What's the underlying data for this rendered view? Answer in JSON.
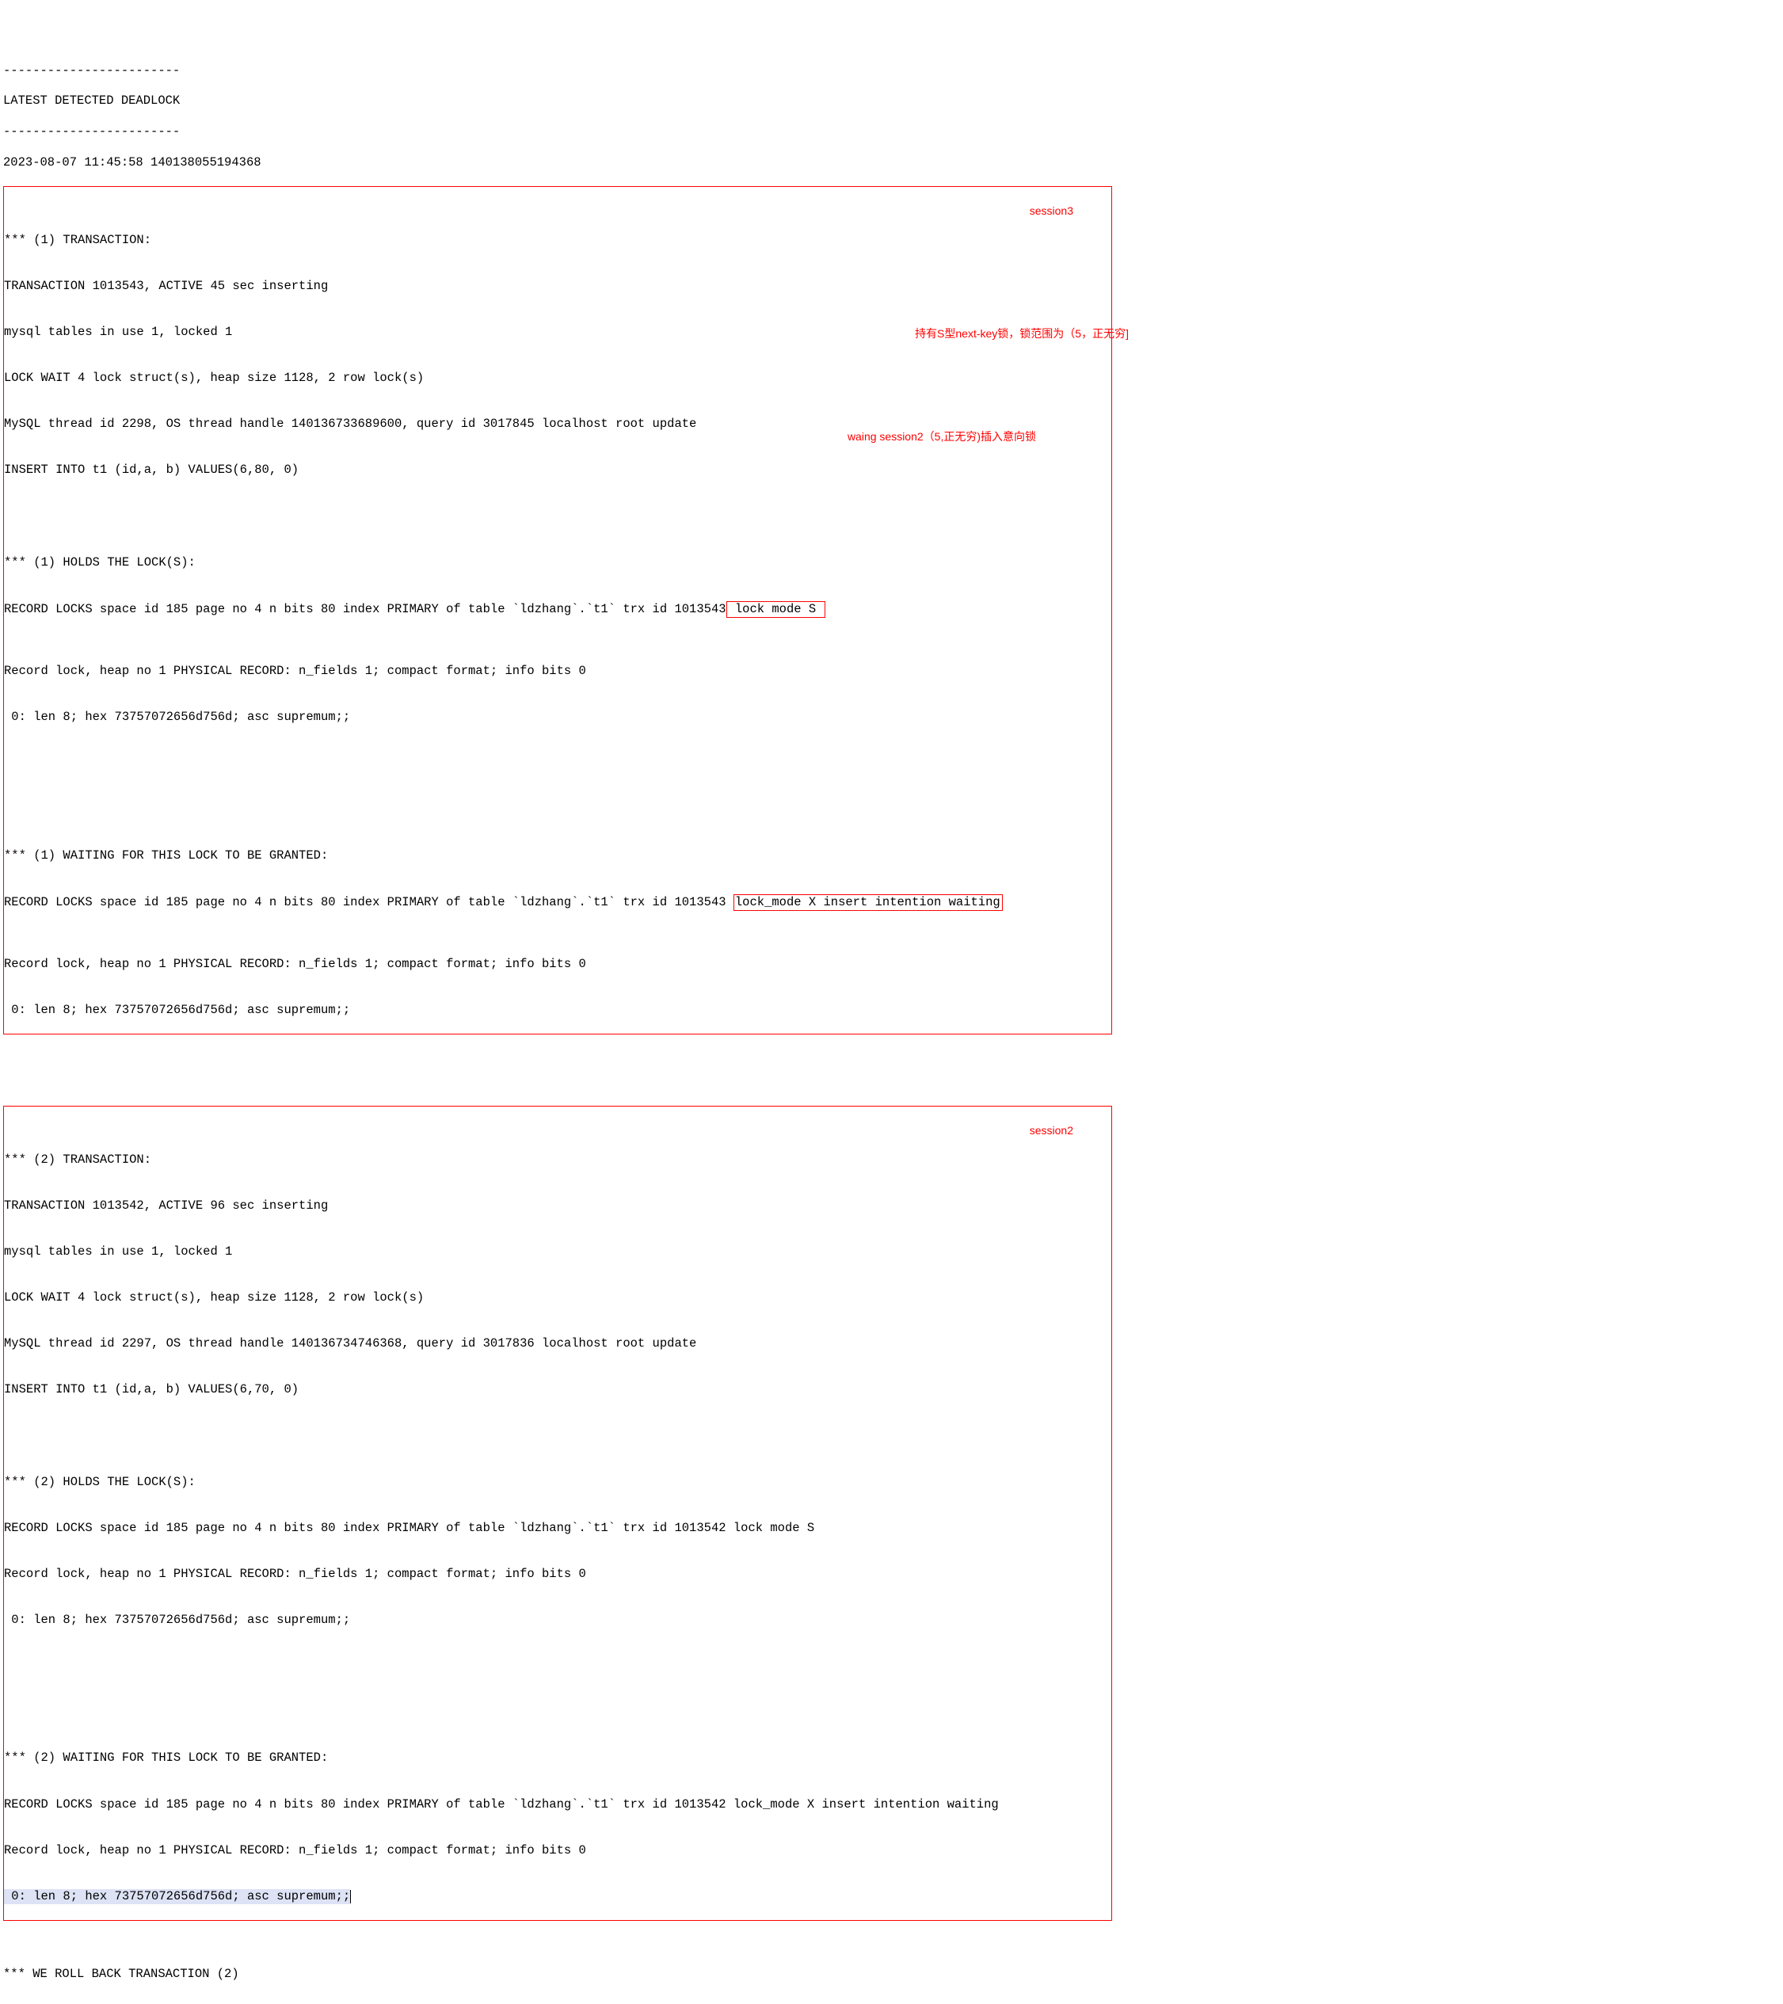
{
  "header": {
    "dashes_top": "------------------------",
    "title": "LATEST DETECTED DEADLOCK",
    "dashes_bottom": "------------------------",
    "timestamp_line": "2023-08-07 11:45:58 140138055194368"
  },
  "tx1": {
    "session_label": "session3",
    "l1": "*** (1) TRANSACTION:",
    "l2": "TRANSACTION 1013543, ACTIVE 45 sec inserting",
    "l3": "mysql tables in use 1, locked 1",
    "l4": "LOCK WAIT 4 lock struct(s), heap size 1128, 2 row lock(s)",
    "l5": "MySQL thread id 2298, OS thread handle 140136733689600, query id 3017845 localhost root update",
    "l6": "INSERT INTO t1 (id,a, b) VALUES(6,80, 0)",
    "holds_title": "*** (1) HOLDS THE LOCK(S):",
    "holds_prefix": "RECORD LOCKS space id 185 page no 4 n bits 80 index PRIMARY of table `ldzhang`.`t1` trx id 1013543",
    "holds_box": " lock mode S ",
    "holds_annot": "持有S型next-key锁，锁范围为（5，正无穷]",
    "holds_r2": "Record lock, heap no 1 PHYSICAL RECORD: n_fields 1; compact format; info bits 0",
    "holds_r3": " 0: len 8; hex 73757072656d756d; asc supremum;;",
    "wait_title": "*** (1) WAITING FOR THIS LOCK TO BE GRANTED:",
    "wait_prefix": "RECORD LOCKS space id 185 page no 4 n bits 80 index PRIMARY of table `ldzhang`.`t1` trx id 1013543 ",
    "wait_box": "lock_mode X insert intention waiting",
    "wait_annot": "waing session2（5,正无穷)插入意向锁",
    "wait_r2": "Record lock, heap no 1 PHYSICAL RECORD: n_fields 1; compact format; info bits 0",
    "wait_r3": " 0: len 8; hex 73757072656d756d; asc supremum;;"
  },
  "tx2": {
    "session_label": "session2",
    "l1": "*** (2) TRANSACTION:",
    "l2": "TRANSACTION 1013542, ACTIVE 96 sec inserting",
    "l3": "mysql tables in use 1, locked 1",
    "l4": "LOCK WAIT 4 lock struct(s), heap size 1128, 2 row lock(s)",
    "l5": "MySQL thread id 2297, OS thread handle 140136734746368, query id 3017836 localhost root update",
    "l6": "INSERT INTO t1 (id,a, b) VALUES(6,70, 0)",
    "holds_title": "*** (2) HOLDS THE LOCK(S):",
    "holds_r1": "RECORD LOCKS space id 185 page no 4 n bits 80 index PRIMARY of table `ldzhang`.`t1` trx id 1013542 lock mode S",
    "holds_r2": "Record lock, heap no 1 PHYSICAL RECORD: n_fields 1; compact format; info bits 0",
    "holds_r3": " 0: len 8; hex 73757072656d756d; asc supremum;;",
    "wait_title": "*** (2) WAITING FOR THIS LOCK TO BE GRANTED:",
    "wait_r1": "RECORD LOCKS space id 185 page no 4 n bits 80 index PRIMARY of table `ldzhang`.`t1` trx id 1013542 lock_mode X insert intention waiting",
    "wait_r2": "Record lock, heap no 1 PHYSICAL RECORD: n_fields 1; compact format; info bits 0",
    "wait_r3": " 0: len 8; hex 73757072656d756d; asc supremum;;"
  },
  "footer": {
    "rollback": "*** WE ROLL BACK TRANSACTION (2)"
  }
}
